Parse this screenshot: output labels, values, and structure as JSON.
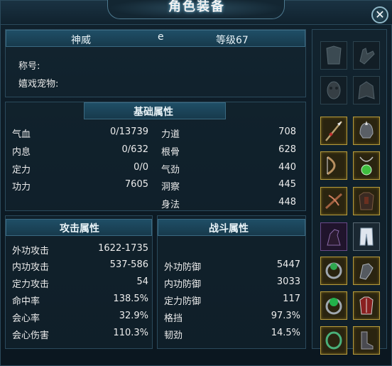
{
  "window": {
    "title": "角色装备",
    "close_glyph": "✕"
  },
  "character": {
    "name": "神威",
    "guild_glyph": "e",
    "level": "等级67",
    "title_label": "称号:",
    "pet_label": "嬉戏宠物:"
  },
  "basic": {
    "header": "基础属性",
    "left": [
      {
        "label": "气血",
        "value": "0/13739"
      },
      {
        "label": "内息",
        "value": "0/632"
      },
      {
        "label": "定力",
        "value": "0/0"
      },
      {
        "label": "功力",
        "value": "7605"
      }
    ],
    "right": [
      {
        "label": "力道",
        "value": "708"
      },
      {
        "label": "根骨",
        "value": "628"
      },
      {
        "label": "气劲",
        "value": "440"
      },
      {
        "label": "洞察",
        "value": "445"
      },
      {
        "label": "身法",
        "value": "448"
      }
    ]
  },
  "attack": {
    "header": "攻击属性",
    "rows": [
      {
        "label": "外功攻击",
        "value": "1622-1735"
      },
      {
        "label": "内功攻击",
        "value": "537-586"
      },
      {
        "label": "定力攻击",
        "value": "54"
      },
      {
        "label": "命中率",
        "value": "138.5%"
      },
      {
        "label": "会心率",
        "value": "32.9%"
      },
      {
        "label": "会心伤害",
        "value": "110.3%"
      }
    ]
  },
  "combat": {
    "header": "战斗属性",
    "rows": [
      {
        "label": "外功防御",
        "value": "5447"
      },
      {
        "label": "内功防御",
        "value": "3033"
      },
      {
        "label": "定力防御",
        "value": "117"
      },
      {
        "label": "格挡",
        "value": "97.3%"
      },
      {
        "label": "韧劲",
        "value": "14.5%"
      }
    ]
  },
  "equipment": {
    "slots": [
      {
        "icon": "armor-piece-icon",
        "state": "empty"
      },
      {
        "icon": "glove-icon",
        "state": "empty"
      },
      {
        "icon": "mask-icon",
        "state": "empty"
      },
      {
        "icon": "cloak-icon",
        "state": "empty"
      },
      {
        "icon": "spear-icon",
        "state": "equipped"
      },
      {
        "icon": "helmet-icon",
        "state": "equipped"
      },
      {
        "icon": "bow-icon",
        "state": "equipped"
      },
      {
        "icon": "jade-necklace-icon",
        "state": "equipped"
      },
      {
        "icon": "crossbow-icon",
        "state": "equipped"
      },
      {
        "icon": "body-armor-icon",
        "state": "equipped"
      },
      {
        "icon": "horse-icon",
        "state": "normal"
      },
      {
        "icon": "trousers-icon",
        "state": "normal"
      },
      {
        "icon": "jade-ring-icon",
        "state": "equipped"
      },
      {
        "icon": "gauntlet-icon",
        "state": "equipped"
      },
      {
        "icon": "jade-ring-2-icon",
        "state": "equipped"
      },
      {
        "icon": "red-armor-icon",
        "state": "equipped"
      },
      {
        "icon": "bracelet-icon",
        "state": "equipped"
      },
      {
        "icon": "boots-icon",
        "state": "equipped"
      }
    ]
  }
}
